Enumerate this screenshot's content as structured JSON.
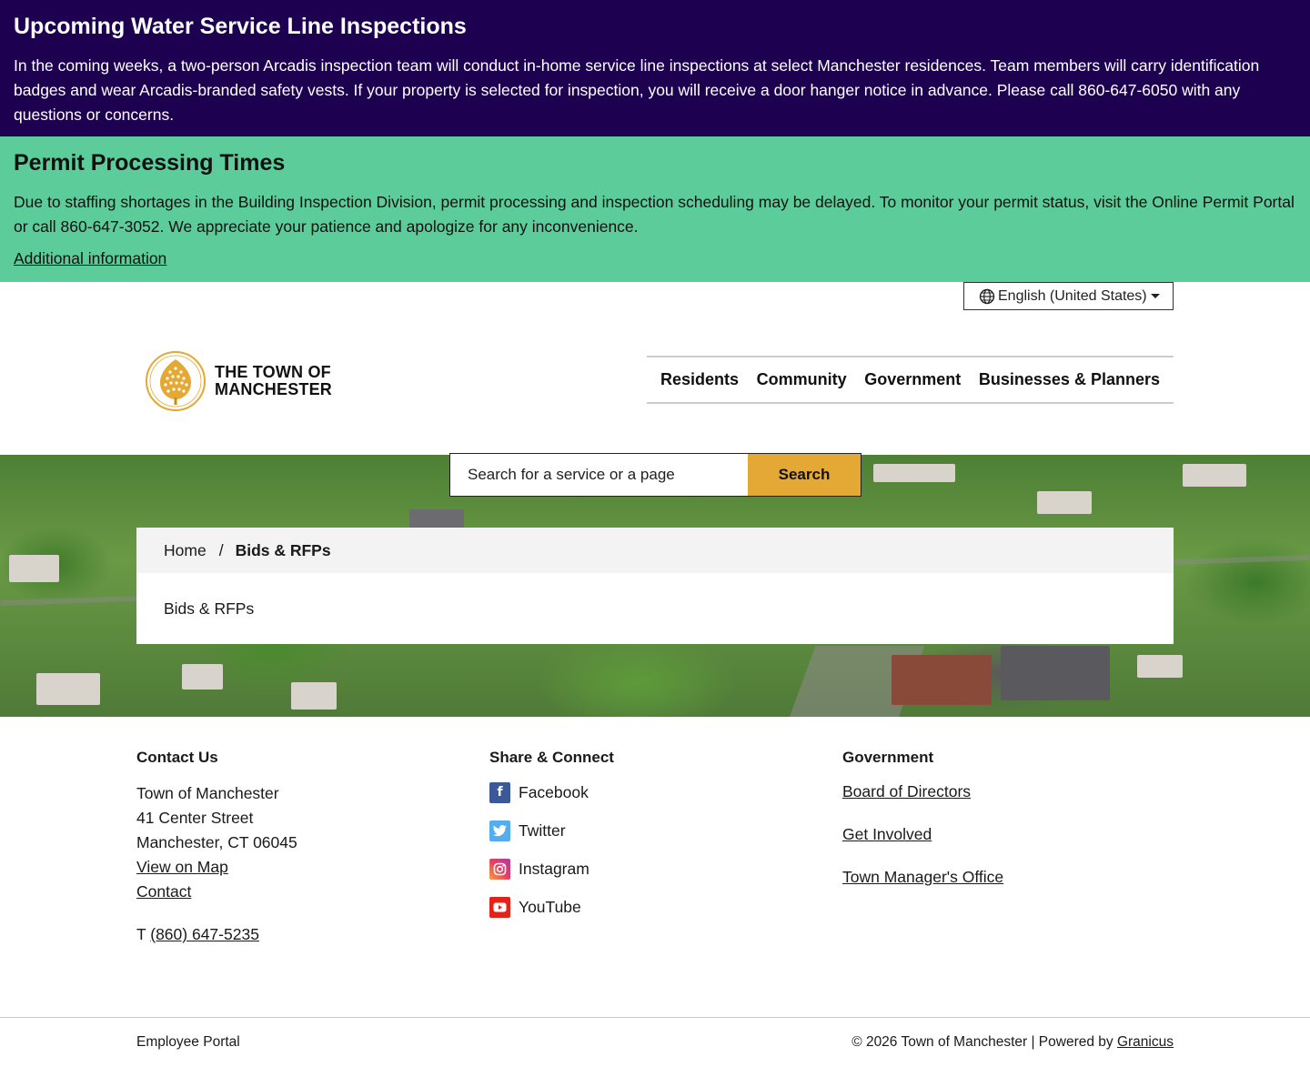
{
  "alerts": {
    "water": {
      "title": "Upcoming Water Service Line Inspections",
      "body": "In the coming weeks, a two-person Arcadis inspection team will conduct in-home service line inspections at select Manchester residences. Team members will carry identification badges and wear Arcadis-branded safety vests. If your property is selected for inspection, you will receive a door hanger notice in advance. Please call 860-647-6050 with any questions or concerns."
    },
    "permit": {
      "title": "Permit Processing Times",
      "body": "Due to staffing shortages in the Building Inspection Division, permit processing and inspection scheduling may be delayed. To monitor your permit status, visit the Online Permit Portal or call 860-647-3052. We appreciate your patience and apologize for any inconvenience.",
      "link": "Additional information"
    }
  },
  "language": {
    "selected": "English (United States)"
  },
  "header": {
    "logo_line1": "THE TOWN OF",
    "logo_line2": "MANCHESTER",
    "nav": [
      "Residents",
      "Community",
      "Government",
      "Businesses & Planners"
    ]
  },
  "search": {
    "placeholder": "Search for a service or a page",
    "button": "Search"
  },
  "breadcrumb": {
    "home": "Home",
    "separator": "/",
    "current": "Bids & RFPs"
  },
  "page": {
    "title": "Bids & RFPs"
  },
  "footer": {
    "contact": {
      "heading": "Contact Us",
      "name": "Town of Manchester",
      "street": "41 Center Street",
      "city": "Manchester, CT 06045",
      "map_link": "View on Map",
      "contact_link": "Contact",
      "phone_prefix": "T",
      "phone": "(860) 647-5235"
    },
    "social": {
      "heading": "Share & Connect",
      "items": [
        "Facebook",
        "Twitter",
        "Instagram",
        "YouTube"
      ]
    },
    "government": {
      "heading": "Government",
      "links": [
        "Board of Directors",
        "Get Involved",
        "Town Manager's Office"
      ]
    },
    "employee_portal": "Employee Portal",
    "copyright": "© 2026 Town of Manchester | Powered by",
    "powered_by": "Granicus"
  },
  "colors": {
    "alert_purple": "#1e0050",
    "alert_green": "#5ccc9b",
    "search_button": "#e3a934",
    "facebook": "#3b5998",
    "twitter": "#55acee",
    "instagram": "#e4405f",
    "youtube": "#e62117"
  }
}
